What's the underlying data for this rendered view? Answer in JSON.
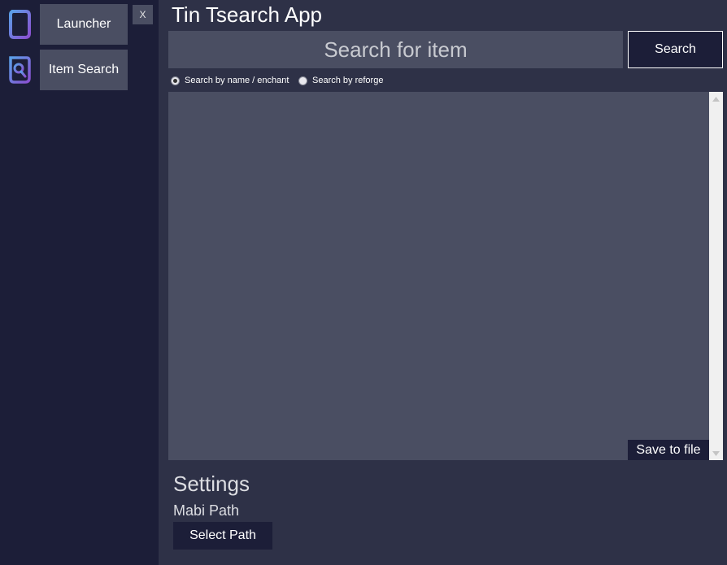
{
  "app": {
    "title": "Tin Tsearch App"
  },
  "sidebar": {
    "items": [
      {
        "label": "Launcher",
        "icon": "launcher-icon"
      },
      {
        "label": "Item Search",
        "icon": "item-search-icon"
      }
    ],
    "close_label": "X"
  },
  "search": {
    "placeholder": "Search for item",
    "value": "",
    "button_label": "Search",
    "modes": [
      {
        "label": "Search by name / enchant",
        "selected": true
      },
      {
        "label": "Search by reforge",
        "selected": false
      }
    ]
  },
  "results": {
    "items": [],
    "save_label": "Save to file"
  },
  "settings": {
    "title": "Settings",
    "path_label": "Mabi Path",
    "select_path_label": "Select Path"
  },
  "colors": {
    "sidebar_bg": "#1c1e38",
    "main_bg": "#2e3147",
    "panel_bg": "#4a4e62",
    "icon_accent": "#6a5cd6"
  }
}
